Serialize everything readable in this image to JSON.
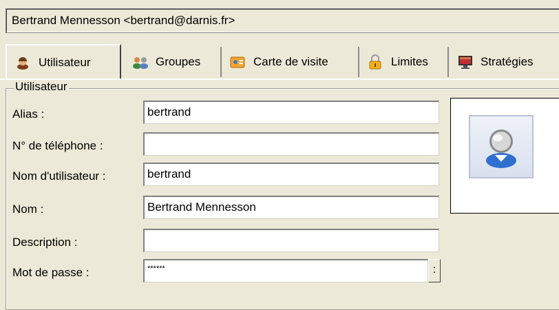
{
  "header": {
    "account": "Bertrand Mennesson <bertrand@darnis.fr>"
  },
  "tabs": [
    {
      "label": "Utilisateur",
      "icon": "user-icon",
      "active": true
    },
    {
      "label": "Groupes",
      "icon": "groups-icon",
      "active": false
    },
    {
      "label": "Carte de visite",
      "icon": "business-card-icon",
      "active": false
    },
    {
      "label": "Limites",
      "icon": "lock-icon",
      "active": false
    },
    {
      "label": "Stratégies",
      "icon": "monitor-icon",
      "active": false
    }
  ],
  "group": {
    "title": "Utilisateur"
  },
  "fields": {
    "alias": {
      "label": "Alias :",
      "value": "bertrand"
    },
    "phone": {
      "label": "N° de téléphone :",
      "value": ""
    },
    "username": {
      "label": "Nom d'utilisateur :",
      "value": "bertrand"
    },
    "name": {
      "label": "Nom :",
      "value": "Bertrand Mennesson"
    },
    "description": {
      "label": "Description :",
      "value": ""
    },
    "password": {
      "label": "Mot de passe :",
      "value": "******",
      "button": ":"
    }
  },
  "photo": {
    "icon": "user-avatar-icon"
  }
}
